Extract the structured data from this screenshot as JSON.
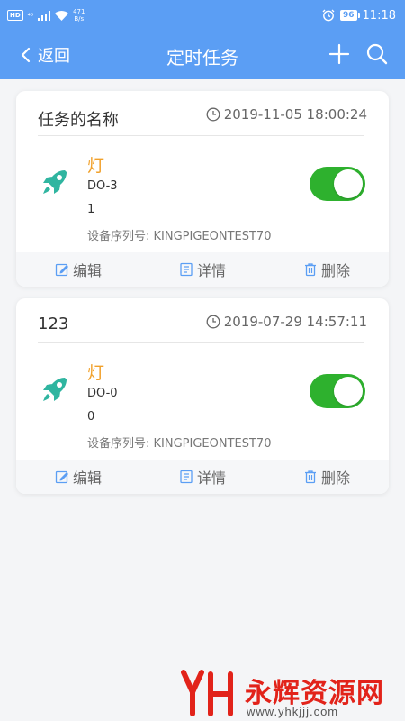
{
  "statusbar": {
    "hd": "HD",
    "signal_label": "⁴⁶",
    "net_speed": "471",
    "net_unit": "B/s",
    "battery": "96",
    "time": "11:18"
  },
  "nav": {
    "back_label": "返回",
    "title": "定时任务"
  },
  "tasks": [
    {
      "name": "任务的名称",
      "time": "2019-11-05 18:00:24",
      "device_name": "灯",
      "port": "DO-3",
      "value": "1",
      "serial": "设备序列号: KINGPIGEONTEST70",
      "enabled": true
    },
    {
      "name": "123",
      "time": "2019-07-29 14:57:11",
      "device_name": "灯",
      "port": "DO-0",
      "value": "0",
      "serial": "设备序列号: KINGPIGEONTEST70",
      "enabled": true
    }
  ],
  "actions": {
    "edit": "编辑",
    "detail": "详情",
    "delete": "删除"
  },
  "watermark": {
    "text": "永辉资源网",
    "url": "www.yhkjjj.com"
  },
  "colors": {
    "primary": "#5b9ef4",
    "accent_orange": "#f1a12b",
    "toggle_on": "#2eb12e",
    "rocket": "#2fb5a0",
    "watermark_red": "#e2231a"
  }
}
